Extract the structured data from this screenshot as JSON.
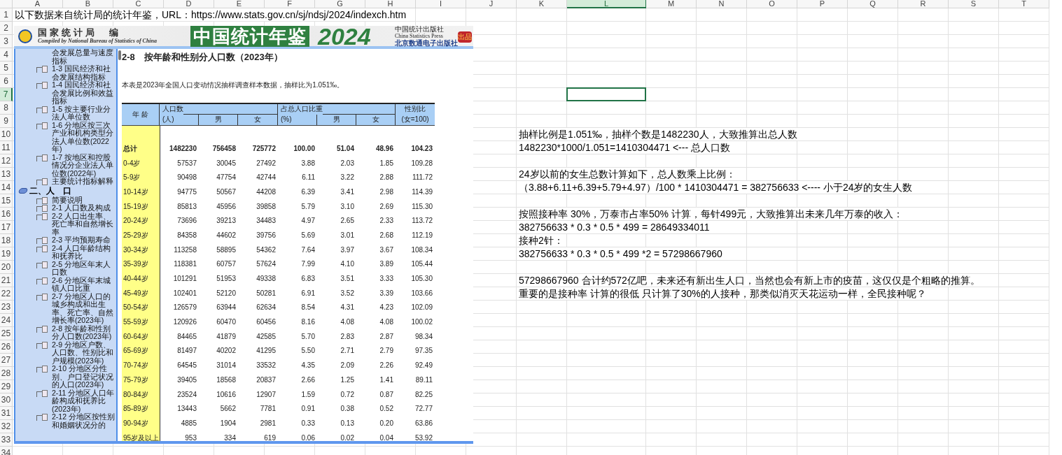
{
  "sheet": {
    "columns": [
      {
        "label": "A",
        "selected": false
      },
      {
        "label": "B",
        "selected": false
      },
      {
        "label": "C",
        "selected": false
      },
      {
        "label": "D",
        "selected": false
      },
      {
        "label": "E",
        "selected": false
      },
      {
        "label": "F",
        "selected": false
      },
      {
        "label": "G",
        "selected": false
      },
      {
        "label": "H",
        "selected": false
      },
      {
        "label": "I",
        "selected": false
      },
      {
        "label": "J",
        "selected": false
      },
      {
        "label": "K",
        "selected": false
      },
      {
        "label": "L",
        "selected": true
      },
      {
        "label": "M",
        "selected": false
      },
      {
        "label": "N",
        "selected": false
      },
      {
        "label": "O",
        "selected": false
      },
      {
        "label": "P",
        "selected": false
      },
      {
        "label": "Q",
        "selected": false
      },
      {
        "label": "R",
        "selected": false
      },
      {
        "label": "S",
        "selected": false
      },
      {
        "label": "T",
        "selected": false
      }
    ],
    "rows": [
      {
        "label": "1",
        "selected": false
      },
      {
        "label": "2",
        "selected": false
      },
      {
        "label": "3",
        "selected": false
      },
      {
        "label": "4",
        "selected": false
      },
      {
        "label": "5",
        "selected": false
      },
      {
        "label": "6",
        "selected": false
      },
      {
        "label": "7",
        "selected": true
      },
      {
        "label": "8",
        "selected": false
      },
      {
        "label": "9",
        "selected": false
      },
      {
        "label": "10",
        "selected": false
      },
      {
        "label": "11",
        "selected": false
      },
      {
        "label": "12",
        "selected": false
      },
      {
        "label": "13",
        "selected": false
      },
      {
        "label": "14",
        "selected": false
      },
      {
        "label": "15",
        "selected": false
      },
      {
        "label": "16",
        "selected": false
      },
      {
        "label": "17",
        "selected": false
      },
      {
        "label": "18",
        "selected": false
      },
      {
        "label": "19",
        "selected": false
      },
      {
        "label": "20",
        "selected": false
      },
      {
        "label": "21",
        "selected": false
      },
      {
        "label": "22",
        "selected": false
      },
      {
        "label": "23",
        "selected": false
      },
      {
        "label": "24",
        "selected": false
      },
      {
        "label": "25",
        "selected": false
      },
      {
        "label": "26",
        "selected": false
      },
      {
        "label": "27",
        "selected": false
      },
      {
        "label": "28",
        "selected": false
      },
      {
        "label": "29",
        "selected": false
      },
      {
        "label": "30",
        "selected": false
      },
      {
        "label": "31",
        "selected": false
      },
      {
        "label": "32",
        "selected": false
      },
      {
        "label": "33",
        "selected": false
      },
      {
        "label": "34",
        "selected": false
      }
    ],
    "cell_a1": "以下数据来自统计局的统计年鉴，URL：https://www.stats.gov.cn/sj/ndsj/2024/indexch.htm",
    "notes": [
      [
        "抽样比例是1.051‰，抽样个数是1482230人，大致推算出总人数",
        "1482230*1000/1.051=1410304471  <--- 总人口数"
      ],
      [
        "24岁以前的女生总数计算如下，总人数乘上比例：",
        "（3.88+6.11+6.39+5.79+4.97）/100 * 1410304471 = 382756633    <---- 小于24岁的女生人数"
      ],
      [
        "按照接种率 30%，万泰市占率50% 计算，每针499元，大致推算出未来几年万泰的收入：",
        "382756633 * 0.3 * 0.5 * 499 = 28649334011",
        "接种2针：",
        "382756633 * 0.3 * 0.5 * 499 *2 = 57298667960"
      ],
      [
        "57298667960 合计约572亿吧，未来还有新出生人口，当然也会有新上市的疫苗，这仅仅是个粗略的推算。",
        "重要的是接种率 计算的很低 只计算了30%的人接种，那类似消灭天花运动一样，全民接种呢？"
      ]
    ]
  },
  "pasted_image": {
    "banner": {
      "editor": "国家统计局　编",
      "editor_en": "Compiled by National Bureau of Statistics of China",
      "title": "中国统计年鉴",
      "year": "2024",
      "press": "中国统计出版社",
      "press_en": "China Statistics Press",
      "press2": "北京数通电子出版社",
      "badge": "出品"
    },
    "tree": [
      {
        "children": [
          {
            "kind": "continuation",
            "label": "会发展总量与速度指标"
          },
          {
            "kind": "page",
            "label": "1-3 国民经济和社会发展结构指标"
          },
          {
            "kind": "page",
            "label": "1-4 国民经济和社会发展比例和效益指标"
          },
          {
            "kind": "page",
            "label": "1-5 按主要行业分法人单位数"
          },
          {
            "kind": "page",
            "label": "1-6 分地区按三次产业和机构类型分法人单位数(2022年)"
          },
          {
            "kind": "page",
            "label": "1-7 按地区和控股情况分企业法人单位数(2022年)"
          },
          {
            "kind": "page",
            "label": "主要统计指标解释"
          }
        ]
      },
      {
        "label": "二、人　口",
        "expanded": true,
        "children": [
          {
            "kind": "page",
            "label": "简要说明"
          },
          {
            "kind": "page",
            "label": "2-1 人口数及构成"
          },
          {
            "kind": "page",
            "label": "2-2 人口出生率、死亡率和自然增长率"
          },
          {
            "kind": "page",
            "label": "2-3 平均预期寿命"
          },
          {
            "kind": "page",
            "label": "2-4 人口年龄结构和抚养比"
          },
          {
            "kind": "page",
            "label": "2-5 分地区年末人口数"
          },
          {
            "kind": "page",
            "label": "2-6 分地区年末城镇人口比重"
          },
          {
            "kind": "page",
            "label": "2-7 分地区人口的城乡构成和出生率、死亡率、自然增长率(2023年)"
          },
          {
            "kind": "page",
            "label": "2-8 按年龄和性别分人口数(2023年)"
          },
          {
            "kind": "page",
            "label": "2-9 分地区户数、人口数、性别比和户规模(2023年)"
          },
          {
            "kind": "page",
            "label": "2-10 分地区分性别、户口登记状况的人口(2023年)"
          },
          {
            "kind": "page",
            "label": "2-11 分地区人口年龄构成和抚养比(2023年)"
          },
          {
            "kind": "page",
            "label": "2-12 分地区按性别和婚姻状况分的"
          }
        ]
      }
    ],
    "table": {
      "title": "2-8　按年龄和性别分人口数（2023年）",
      "note": "本表是2023年全国人口变动情况抽样调查样本数据，抽样比为1.051‰。",
      "header": {
        "age": "年 龄",
        "population": "人口数",
        "population_unit": "(人)",
        "male": "男",
        "female": "女",
        "share": "占总人口比重",
        "share_unit": "(%)",
        "share_male": "男",
        "share_female": "女",
        "sex_ratio": "性别比",
        "sex_ratio_unit": "(女=100)"
      },
      "rows": [
        {
          "kind": "total",
          "age": "总计",
          "values": [
            "1482230",
            "756458",
            "725772",
            "100.00",
            "51.04",
            "48.96",
            "104.23"
          ]
        },
        {
          "kind": "age",
          "age": "0-4岁",
          "values": [
            "57537",
            "30045",
            "27492",
            "3.88",
            "2.03",
            "1.85",
            "109.28"
          ]
        },
        {
          "kind": "age",
          "age": "5-9岁",
          "values": [
            "90498",
            "47754",
            "42744",
            "6.11",
            "3.22",
            "2.88",
            "111.72"
          ]
        },
        {
          "kind": "age",
          "age": "10-14岁",
          "values": [
            "94775",
            "50567",
            "44208",
            "6.39",
            "3.41",
            "2.98",
            "114.39"
          ]
        },
        {
          "kind": "age",
          "age": "15-19岁",
          "values": [
            "85813",
            "45956",
            "39858",
            "5.79",
            "3.10",
            "2.69",
            "115.30"
          ]
        },
        {
          "kind": "age",
          "age": "20-24岁",
          "values": [
            "73696",
            "39213",
            "34483",
            "4.97",
            "2.65",
            "2.33",
            "113.72"
          ]
        },
        {
          "kind": "age",
          "age": "25-29岁",
          "values": [
            "84358",
            "44602",
            "39756",
            "5.69",
            "3.01",
            "2.68",
            "112.19"
          ]
        },
        {
          "kind": "age",
          "age": "30-34岁",
          "values": [
            "113258",
            "58895",
            "54362",
            "7.64",
            "3.97",
            "3.67",
            "108.34"
          ]
        },
        {
          "kind": "age",
          "age": "35-39岁",
          "values": [
            "118381",
            "60757",
            "57624",
            "7.99",
            "4.10",
            "3.89",
            "105.44"
          ]
        },
        {
          "kind": "age",
          "age": "40-44岁",
          "values": [
            "101291",
            "51953",
            "49338",
            "6.83",
            "3.51",
            "3.33",
            "105.30"
          ]
        },
        {
          "kind": "age",
          "age": "45-49岁",
          "values": [
            "102401",
            "52120",
            "50281",
            "6.91",
            "3.52",
            "3.39",
            "103.66"
          ]
        },
        {
          "kind": "age",
          "age": "50-54岁",
          "values": [
            "126579",
            "63944",
            "62634",
            "8.54",
            "4.31",
            "4.23",
            "102.09"
          ]
        },
        {
          "kind": "age",
          "age": "55-59岁",
          "values": [
            "120926",
            "60470",
            "60456",
            "8.16",
            "4.08",
            "4.08",
            "100.02"
          ]
        },
        {
          "kind": "age",
          "age": "60-64岁",
          "values": [
            "84465",
            "41879",
            "42585",
            "5.70",
            "2.83",
            "2.87",
            "98.34"
          ]
        },
        {
          "kind": "age",
          "age": "65-69岁",
          "values": [
            "81497",
            "40202",
            "41295",
            "5.50",
            "2.71",
            "2.79",
            "97.35"
          ]
        },
        {
          "kind": "age",
          "age": "70-74岁",
          "values": [
            "64545",
            "31014",
            "33532",
            "4.35",
            "2.09",
            "2.26",
            "92.49"
          ]
        },
        {
          "kind": "age",
          "age": "75-79岁",
          "values": [
            "39405",
            "18568",
            "20837",
            "2.66",
            "1.25",
            "1.41",
            "89.11"
          ]
        },
        {
          "kind": "age",
          "age": "80-84岁",
          "values": [
            "23524",
            "10616",
            "12907",
            "1.59",
            "0.72",
            "0.87",
            "82.25"
          ]
        },
        {
          "kind": "age",
          "age": "85-89岁",
          "values": [
            "13443",
            "5662",
            "7781",
            "0.91",
            "0.38",
            "0.52",
            "72.77"
          ]
        },
        {
          "kind": "age",
          "age": "90-94岁",
          "values": [
            "4885",
            "1904",
            "2981",
            "0.33",
            "0.13",
            "0.20",
            "63.86"
          ]
        },
        {
          "kind": "age",
          "age": "95岁及以上",
          "values": [
            "953",
            "334",
            "619",
            "0.06",
            "0.02",
            "0.04",
            "53.92"
          ]
        }
      ]
    }
  }
}
